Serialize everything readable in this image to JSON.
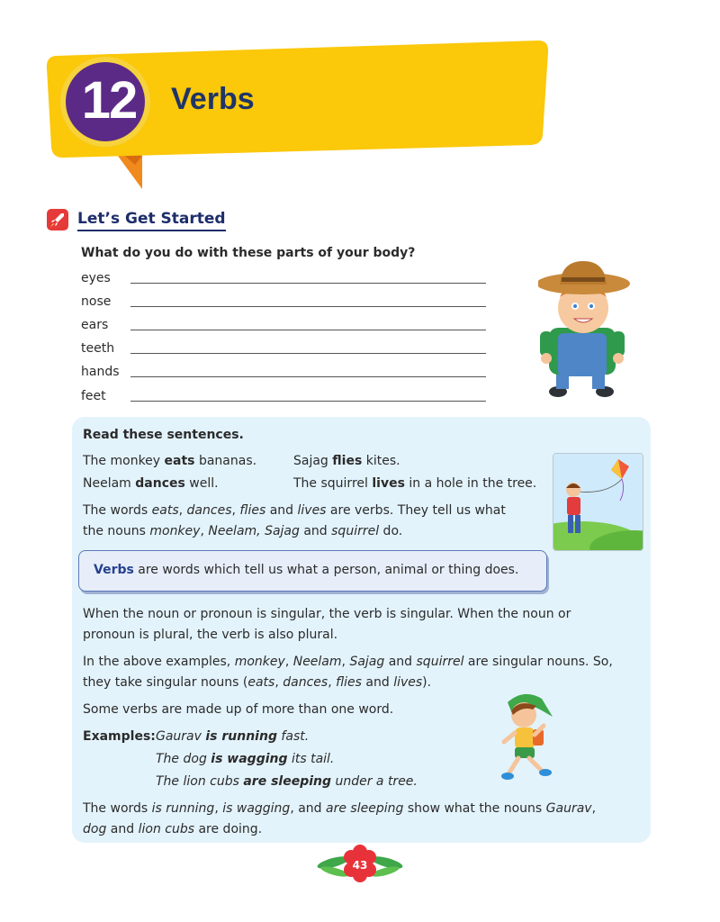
{
  "chapter": {
    "number": "12",
    "title": "Verbs"
  },
  "section": {
    "title": "Let’s Get Started",
    "icon": "rocket-icon"
  },
  "exercise": {
    "question": "What do you do with these parts of your body?",
    "items": [
      "eyes",
      "nose",
      "ears",
      "teeth",
      "hands",
      "feet"
    ]
  },
  "read_box": {
    "heading": "Read these sentences.",
    "s1a": "The monkey ",
    "s1b": "eats",
    "s1c": " bananas.",
    "s2a": "Sajag ",
    "s2b": "flies",
    "s2c": " kites.",
    "s3a": "Neelam ",
    "s3b": "dances",
    "s3c": " well.",
    "s4a": "The squirrel ",
    "s4b": "lives",
    "s4c": " in a hole in the tree.",
    "p1": {
      "a": "The words ",
      "b": "eats",
      "c": ", ",
      "d": "dances",
      "e": ", ",
      "f": "flies",
      "g": " and ",
      "h": "lives",
      "i": " are verbs. They tell us what",
      "j": "the nouns ",
      "k": "monkey",
      "l": ", ",
      "m": "Neelam, Sajag",
      "n": " and ",
      "o": "squirrel",
      "p": " do."
    },
    "definition": {
      "term": "Verbs",
      "rest": " are words which tell us what a person, animal or thing does."
    },
    "p2": {
      "l1": "When the noun or pronoun is singular, the verb is singular. When the noun or",
      "l2": "pronoun is plural, the verb is also plural."
    },
    "p3": {
      "a": "In the above examples, ",
      "b": "monkey",
      "c": ", ",
      "d": "Neelam",
      "e": ", ",
      "f": "Sajag",
      "g": " and ",
      "h": "squirrel",
      "i": " are singular nouns. So,",
      "j": "they take singular nouns (",
      "k": "eats",
      "l": ", ",
      "m": "dances",
      "n": ", ",
      "o": "flies",
      "p": " and ",
      "q": "lives",
      "r": ")."
    },
    "p4": "Some verbs are made up of more than one word.",
    "examples": {
      "label": "Examples:",
      "e1": {
        "a": "Gaurav ",
        "b": "is running",
        "c": " fast."
      },
      "e2": {
        "a": "The dog ",
        "b": "is wagging",
        "c": " its tail."
      },
      "e3": {
        "a": "The lion cubs ",
        "b": "are sleeping",
        "c": " under a tree."
      }
    },
    "p5": {
      "a": "The words ",
      "b": "is running",
      "c": ", ",
      "d": "is wagging",
      "e": ", and ",
      "f": "are sleeping",
      "g": " show what the nouns ",
      "h": "Gaurav",
      "i": ",",
      "j": "dog",
      "k": " and ",
      "l": "lion cubs",
      "m": " are doing."
    }
  },
  "page_number": "43",
  "colors": {
    "banner_yellow": "#fbc80a",
    "banner_orange": "#f18a1e",
    "circle_purple": "#5b2a86",
    "title_navy": "#1f3566",
    "box_blue": "#e3f3fc"
  }
}
